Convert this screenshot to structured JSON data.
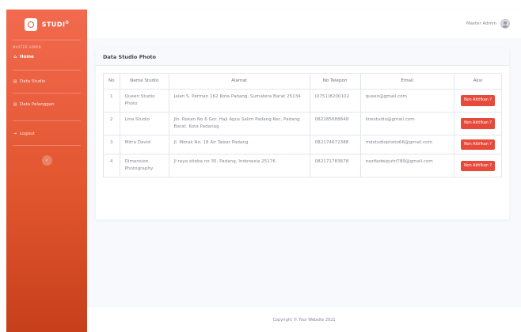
{
  "brand": {
    "name": "STUDI",
    "suffix": "O"
  },
  "sidebar": {
    "heading": "MASTER ADMIN",
    "home_label": "Home",
    "items": [
      {
        "label": "Data Studio"
      },
      {
        "label": "Data Pelanggan"
      }
    ],
    "logout_label": "Logout",
    "toggle_icon": "chevron-left-icon"
  },
  "topbar": {
    "user_name": "Master Admin"
  },
  "card": {
    "title": "Data Studio Photo",
    "columns": [
      "No",
      "Nama Studio",
      "Alamat",
      "No Telepon",
      "Email",
      "Aksi"
    ],
    "rows": [
      {
        "no": "1",
        "nama": "Queen Studio Photo",
        "alamat": "Jalan S. Parman 162 Kota Padang, Sumatera Barat 25134",
        "telepon": "(0751)8200102",
        "email": "queen@gmail.com",
        "aksi": "Non Aktifkan ?"
      },
      {
        "no": "2",
        "nama": "Line Studio",
        "alamat": "Jln. Rokan No 6 Gor. Haji Agus Salim Padang Kec, Padang Barat. Kota Padanag",
        "telepon": "082285688848",
        "email": "linestudio@gmail.com",
        "aksi": "Non Aktifkan ?"
      },
      {
        "no": "3",
        "nama": "Mitra David",
        "alamat": "Jl. Merak No. 18 Air Tawar Padang",
        "telepon": "082174672388",
        "email": "mdstudiophoto66@gmail.com",
        "aksi": "Non Aktifkan ?"
      },
      {
        "no": "4",
        "nama": "Dimension Photography",
        "alamat": "Jl raya siteba no 35, Padang, Indonesia 25176",
        "telepon": "082171783678",
        "email": "nazifadwiputri789@gmail.com",
        "aksi": "Non Aktifkan ?"
      }
    ]
  },
  "footer": {
    "text": "Copyright © Your Website 2021"
  },
  "colors": {
    "sidebar_top": "#f26a4f",
    "sidebar_bottom": "#c6401b",
    "danger": "#e74a3b",
    "muted_text": "#858796"
  }
}
